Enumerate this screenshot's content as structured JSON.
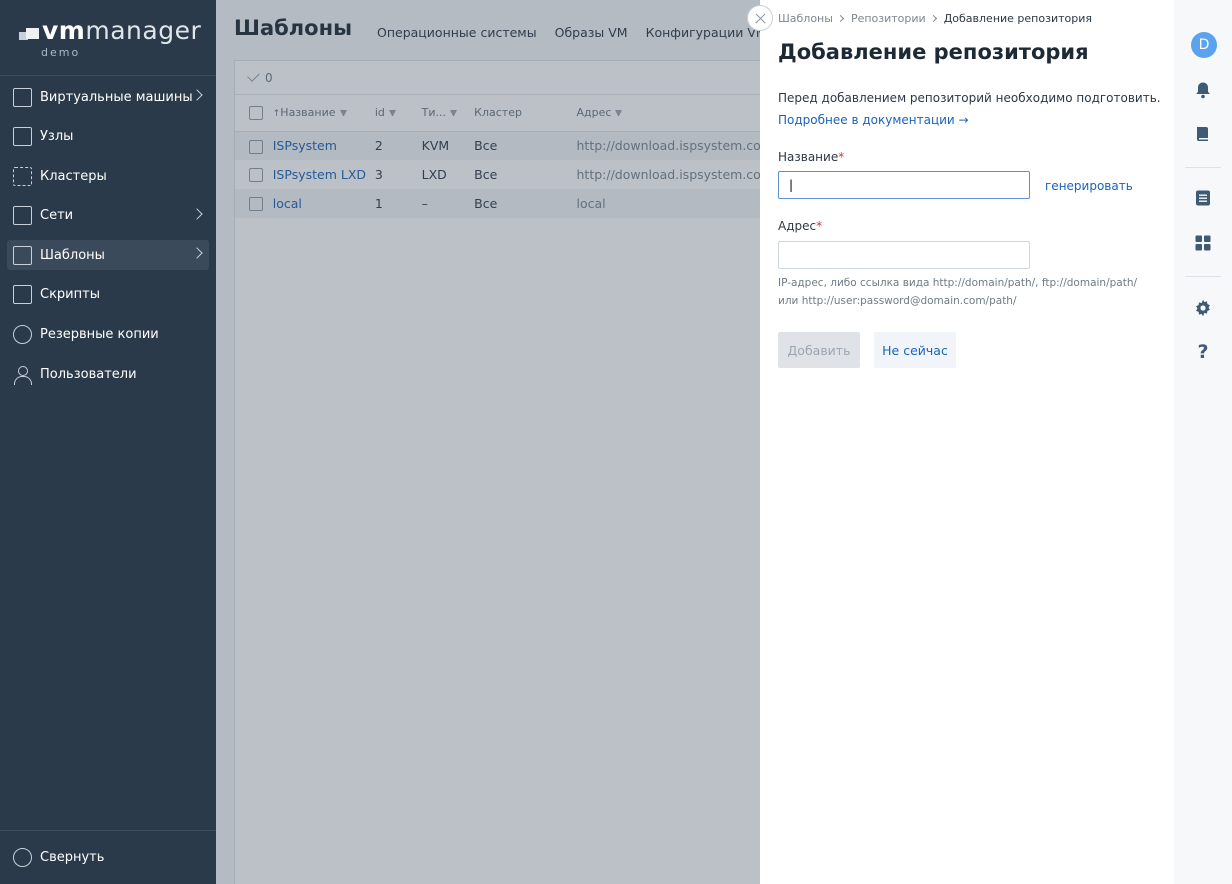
{
  "sidebar": {
    "logo_vm": "vm",
    "logo_manager": "manager",
    "logo_sub": "demo",
    "items": [
      {
        "label": "Виртуальные машины",
        "chevron": true
      },
      {
        "label": "Узлы",
        "chevron": false
      },
      {
        "label": "Кластеры",
        "chevron": false
      },
      {
        "label": "Сети",
        "chevron": true
      },
      {
        "label": "Шаблоны",
        "chevron": true,
        "active": true
      },
      {
        "label": "Скрипты",
        "chevron": false
      },
      {
        "label": "Резервные копии",
        "chevron": false
      },
      {
        "label": "Пользователи",
        "chevron": false
      }
    ],
    "collapse_label": "Свернуть"
  },
  "main": {
    "title": "Шаблоны",
    "tabs": [
      "Операционные системы",
      "Образы VM",
      "Конфигурации VM"
    ],
    "selected_count": "0",
    "columns": {
      "name": "Название",
      "id": "id",
      "type": "Ти...",
      "cluster": "Кластер",
      "address": "Адрес"
    },
    "sort_arrow": "↑",
    "rows": [
      {
        "name": "ISPsystem",
        "id": "2",
        "type": "KVM",
        "cluster": "Все",
        "address": "http://download.ispsystem.com"
      },
      {
        "name": "ISPsystem LXD",
        "id": "3",
        "type": "LXD",
        "cluster": "Все",
        "address": "http://download.ispsystem.com"
      },
      {
        "name": "local",
        "id": "1",
        "type": "–",
        "cluster": "Все",
        "address": "local"
      }
    ]
  },
  "drawer": {
    "breadcrumbs": [
      "Шаблоны",
      "Репозитории",
      "Добавление репозитория"
    ],
    "title": "Добавление репозитория",
    "description": "Перед добавлением репозиторий необходимо подготовить.",
    "doc_link": "Подробнее в документации →",
    "name_label": "Название",
    "name_value": "|",
    "generate_label": "генерировать",
    "address_label": "Адрес",
    "address_value": "",
    "required_mark": "*",
    "hint_line1": "IP-адрес, либо ссылка вида http://domain/path/, ftp://domain/path/",
    "hint_line2": "или http://user:password@domain.com/path/",
    "add_button": "Добавить",
    "later_button": "Не сейчас"
  },
  "rail": {
    "avatar_letter": "D",
    "help_glyph": "?"
  },
  "colors": {
    "sidebar_bg": "#2a3a4a",
    "accent_link": "#1a63b8",
    "avatar": "#5ba3ee",
    "rail_icon": "#3e5a75"
  }
}
